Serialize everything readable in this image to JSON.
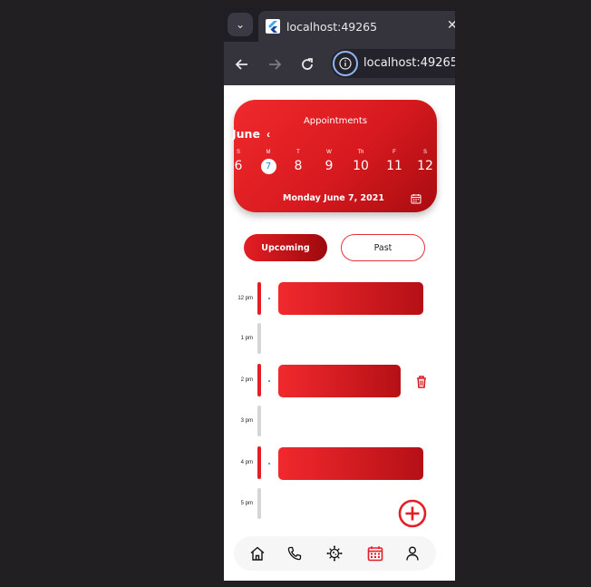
{
  "browser": {
    "tab_title": "localhost:49265",
    "url": "localhost:49265",
    "icons": [
      "tab-list-icon",
      "flutter-favicon",
      "close-icon",
      "back-arrow-icon",
      "forward-arrow-icon",
      "reload-icon",
      "site-info-icon"
    ]
  },
  "calendar": {
    "title": "Appointments",
    "month": "June",
    "days": [
      {
        "weekday": "S",
        "day": "6"
      },
      {
        "weekday": "M",
        "day": "7",
        "selected": true
      },
      {
        "weekday": "T",
        "day": "8"
      },
      {
        "weekday": "W",
        "day": "9"
      },
      {
        "weekday": "Th",
        "day": "10"
      },
      {
        "weekday": "F",
        "day": "11"
      },
      {
        "weekday": "S",
        "day": "12"
      }
    ],
    "selected_date": "Monday  June 7, 2021"
  },
  "segments": {
    "upcoming": "Upcoming",
    "past": "Past",
    "active": "Upcoming"
  },
  "schedule": {
    "slots": [
      {
        "time": "12 pm",
        "has_appointment": true
      },
      {
        "time": "1 pm",
        "has_appointment": false
      },
      {
        "time": "2 pm",
        "has_appointment": true
      },
      {
        "time": "3 pm",
        "has_appointment": false
      },
      {
        "time": "4 pm",
        "has_appointment": true
      },
      {
        "time": "5 pm",
        "has_appointment": false
      }
    ]
  },
  "bottom_nav": {
    "items": [
      "home-icon",
      "phone-icon",
      "virus-icon",
      "calendar-icon",
      "person-icon"
    ],
    "active": "calendar-icon"
  },
  "colors": {
    "accent": "#e41e24",
    "accent_dark": "#9d0a0d",
    "selected_day_text": "#2b8cc7",
    "inactive_slot": "#d5d5d5"
  }
}
